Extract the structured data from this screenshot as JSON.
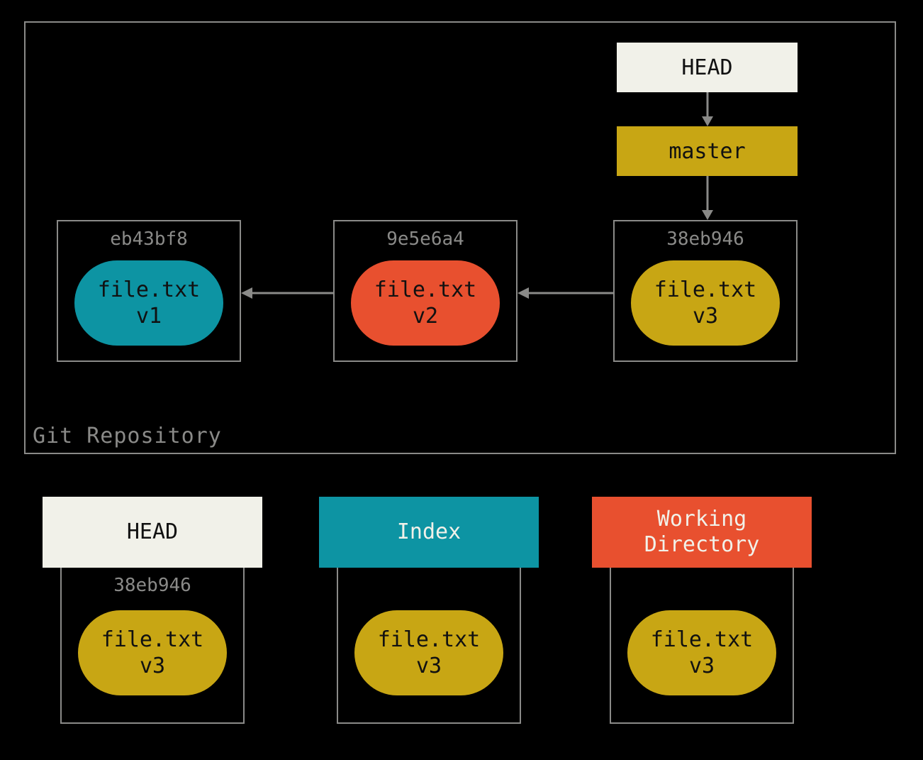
{
  "repo_label": "Git Repository",
  "head_label": "HEAD",
  "branch_label": "master",
  "commits": [
    {
      "hash": "eb43bf8",
      "file": "file.txt",
      "version": "v1"
    },
    {
      "hash": "9e5e6a4",
      "file": "file.txt",
      "version": "v2"
    },
    {
      "hash": "38eb946",
      "file": "file.txt",
      "version": "v3"
    }
  ],
  "areas": [
    {
      "title": "HEAD",
      "hash": "38eb946",
      "file": "file.txt",
      "version": "v3"
    },
    {
      "title": "Index",
      "hash": "",
      "file": "file.txt",
      "version": "v3"
    },
    {
      "title": "Working\nDirectory",
      "hash": "",
      "file": "file.txt",
      "version": "v3"
    }
  ]
}
